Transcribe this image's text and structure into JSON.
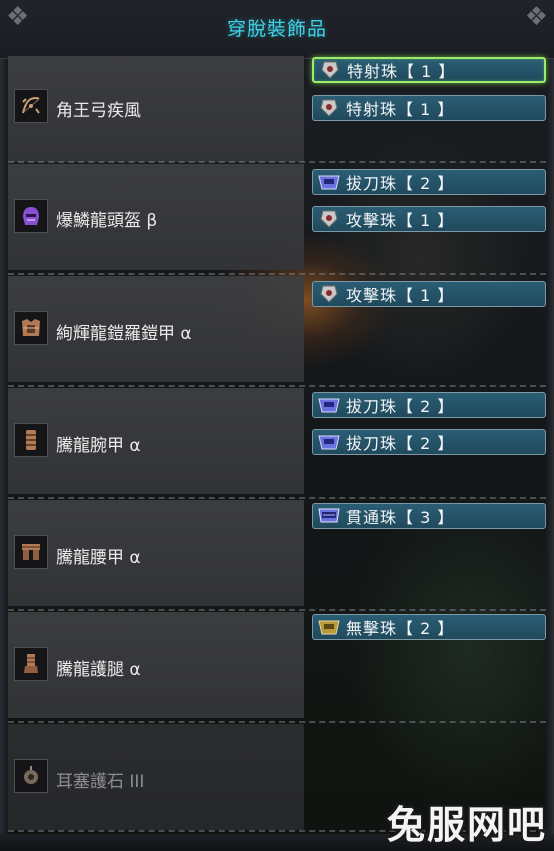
{
  "title": "穿脫裝飾品",
  "equipment": [
    {
      "name": "角王弓疾風",
      "icon": "bow-weapon-icon",
      "jewels": [
        {
          "label": "特射珠【 1 】",
          "level": 1,
          "icon": "jewel-slot-lv1-icon",
          "selected": true
        },
        {
          "label": "特射珠【 1 】",
          "level": 1,
          "icon": "jewel-slot-lv1-icon",
          "selected": false
        }
      ]
    },
    {
      "name": "爆鱗龍頭盔 β",
      "icon": "helmet-armor-icon",
      "jewels": [
        {
          "label": "拔刀珠【 2 】",
          "level": 2,
          "icon": "jewel-slot-lv2-icon",
          "selected": false
        },
        {
          "label": "攻擊珠【 1 】",
          "level": 1,
          "icon": "jewel-slot-lv1-icon",
          "selected": false
        }
      ]
    },
    {
      "name": "絢輝龍鎧羅鎧甲 α",
      "icon": "chest-armor-icon",
      "jewels": [
        {
          "label": "攻擊珠【 1 】",
          "level": 1,
          "icon": "jewel-slot-lv1-icon",
          "selected": false
        }
      ]
    },
    {
      "name": "騰龍腕甲 α",
      "icon": "arm-armor-icon",
      "jewels": [
        {
          "label": "拔刀珠【 2 】",
          "level": 2,
          "icon": "jewel-slot-lv2-icon",
          "selected": false
        },
        {
          "label": "拔刀珠【 2 】",
          "level": 2,
          "icon": "jewel-slot-lv2-icon",
          "selected": false
        }
      ]
    },
    {
      "name": "騰龍腰甲 α",
      "icon": "waist-armor-icon",
      "jewels": [
        {
          "label": "貫通珠【 3 】",
          "level": 3,
          "icon": "jewel-slot-lv3-icon",
          "selected": false
        }
      ]
    },
    {
      "name": "騰龍護腿 α",
      "icon": "leg-armor-icon",
      "jewels": [
        {
          "label": "無擊珠【 2 】",
          "level": 2,
          "icon": "jewel-slot-lv2-icon",
          "selected": false
        }
      ]
    },
    {
      "name": "耳塞護石 III",
      "icon": "charm-icon",
      "jewels": []
    }
  ],
  "watermark": "兔服网吧",
  "colors": {
    "title": "#3fd3e8",
    "jewel_bg": "#2a5d74",
    "selected_border": "#9bec68",
    "jewel_lv1": "#b7b7b7",
    "jewel_lv2": "#6a72e0",
    "jewel_lv3": "#6a72e0"
  }
}
